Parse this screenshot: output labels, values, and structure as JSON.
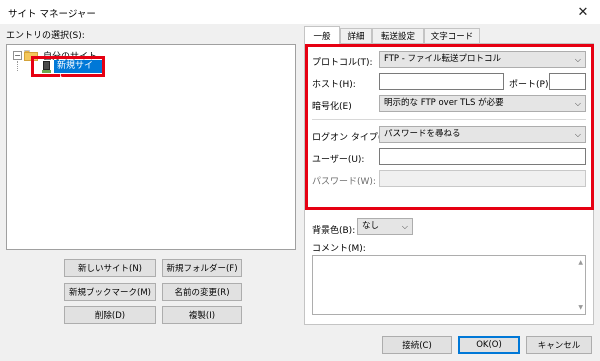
{
  "window": {
    "title": "サイト マネージャー",
    "close_glyph": "✕"
  },
  "left": {
    "section_label": "エントリの選択(S):",
    "tree": {
      "root_label": "自分のサイト",
      "expander": "−",
      "selected_site": "新規サイト"
    },
    "buttons": {
      "new_site": "新しいサイト(N)",
      "new_folder": "新規フォルダー(F)",
      "new_bookmark": "新規ブックマーク(M)",
      "rename": "名前の変更(R)",
      "delete": "削除(D)",
      "duplicate": "複製(I)"
    }
  },
  "tabs": [
    {
      "label": "一般",
      "active": true
    },
    {
      "label": "詳細",
      "active": false
    },
    {
      "label": "転送設定",
      "active": false
    },
    {
      "label": "文字コード",
      "active": false
    }
  ],
  "form": {
    "protocol_label": "プロトコル(T):",
    "protocol_value": "FTP - ファイル転送プロトコル",
    "host_label": "ホスト(H):",
    "host_value": "",
    "port_label": "ポート(P):",
    "port_value": "",
    "encryption_label": "暗号化(E)",
    "encryption_value": "明示的な FTP over TLS が必要",
    "logon_type_label": "ログオン タイプ(L):",
    "logon_type_value": "パスワードを尋ねる",
    "user_label": "ユーザー(U):",
    "user_value": "",
    "password_label": "パスワード(W):",
    "bgcolor_label": "背景色(B):",
    "bgcolor_value": "なし",
    "comment_label": "コメント(M):"
  },
  "footer": {
    "connect": "接続(C)",
    "ok": "OK(O)",
    "cancel": "キャンセル"
  },
  "icons": {
    "dropdown_arrow": "⌵",
    "scroll_up": "▲",
    "scroll_down": "▼"
  },
  "colors": {
    "highlight": "#e60012",
    "selection": "#0078d7"
  }
}
